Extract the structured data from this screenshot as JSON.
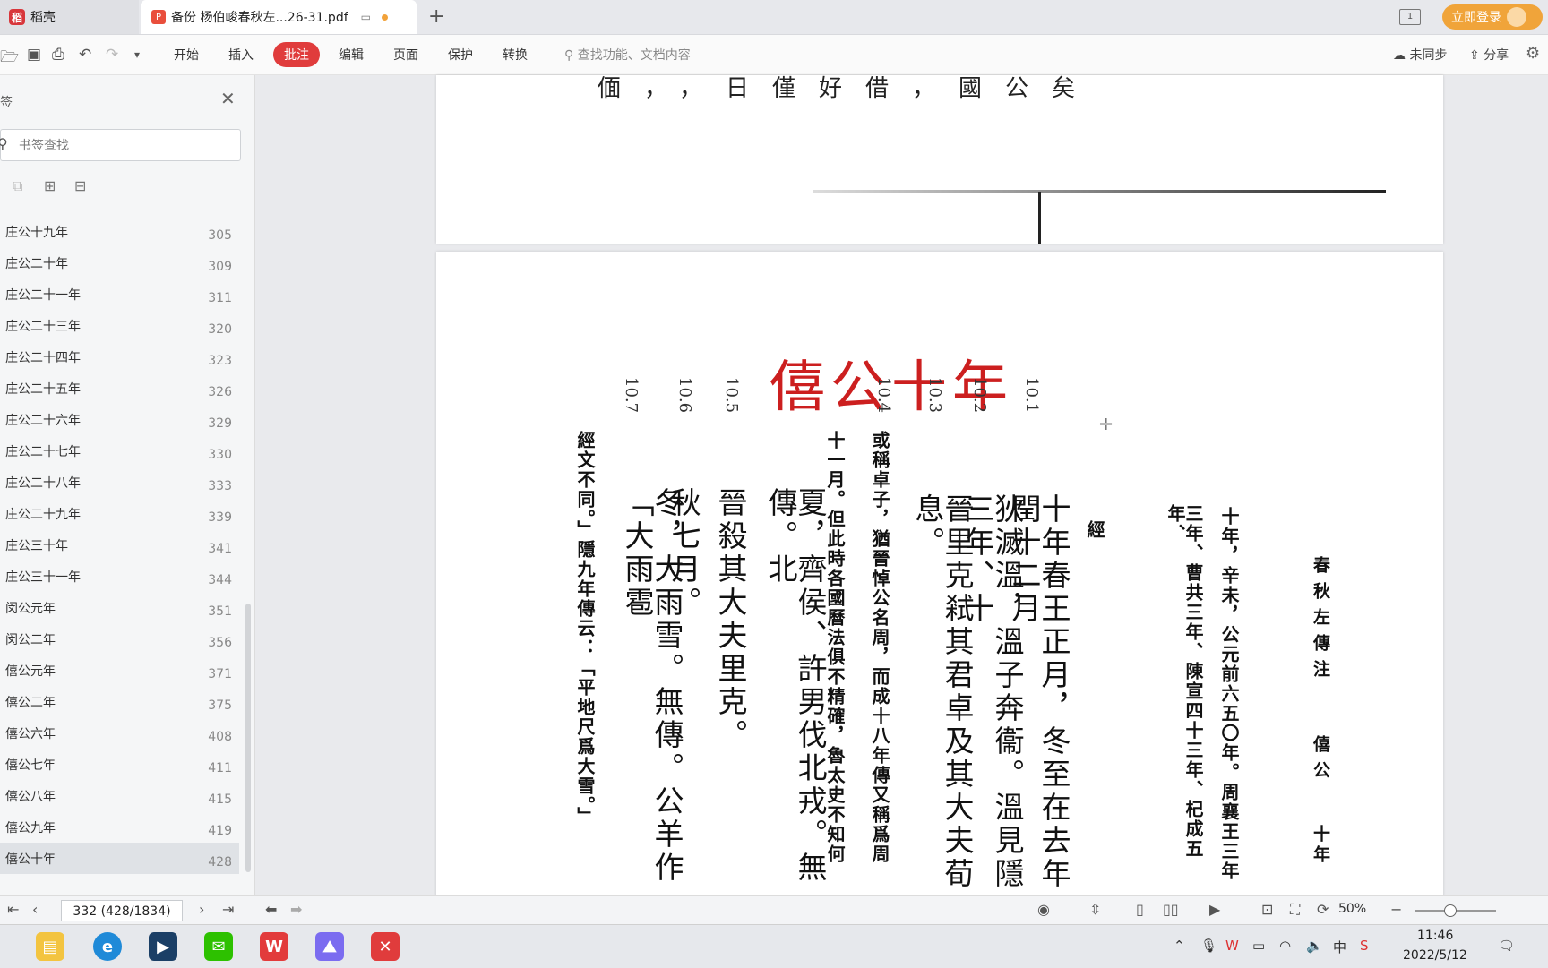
{
  "tabs": {
    "home_label": "稻壳",
    "doc_label": "备份 杨伯峻春秋左...26-31.pdf"
  },
  "header": {
    "login_label": "立即登录",
    "window_num": "1"
  },
  "toolbar": {
    "menus": [
      "开始",
      "插入",
      "批注",
      "编辑",
      "页面",
      "保护",
      "转换"
    ],
    "search_placeholder": "查找功能、文档内容",
    "sync_label": "未同步",
    "share_label": "分享"
  },
  "sidebar": {
    "title": "签",
    "search_placeholder": "书签查找",
    "items": [
      {
        "label": "庄公十九年",
        "page": "305"
      },
      {
        "label": "庄公二十年",
        "page": "309"
      },
      {
        "label": "庄公二十一年",
        "page": "311"
      },
      {
        "label": "庄公二十三年",
        "page": "320"
      },
      {
        "label": "庄公二十四年",
        "page": "323"
      },
      {
        "label": "庄公二十五年",
        "page": "326"
      },
      {
        "label": "庄公二十六年",
        "page": "329"
      },
      {
        "label": "庄公二十七年",
        "page": "330"
      },
      {
        "label": "庄公二十八年",
        "page": "333"
      },
      {
        "label": "庄公二十九年",
        "page": "339"
      },
      {
        "label": "庄公三十年",
        "page": "341"
      },
      {
        "label": "庄公三十一年",
        "page": "344"
      },
      {
        "label": "闵公元年",
        "page": "351"
      },
      {
        "label": "闵公二年",
        "page": "356"
      },
      {
        "label": "僖公元年",
        "page": "371"
      },
      {
        "label": "僖公二年",
        "page": "375"
      },
      {
        "label": "僖公六年",
        "page": "408"
      },
      {
        "label": "僖公七年",
        "page": "411"
      },
      {
        "label": "僖公八年",
        "page": "415"
      },
      {
        "label": "僖公九年",
        "page": "419"
      },
      {
        "label": "僖公十年",
        "page": "428"
      }
    ]
  },
  "document": {
    "top_strip": "偭，，日僅好借，國公矣",
    "title": "僖公十年",
    "header_book": "春秋左傳注",
    "header_duke": "僖公",
    "header_year": "十年",
    "columns": [
      {
        "text": "十年，辛未，公元前六五〇年。周襄王三年",
        "cls": "small"
      },
      {
        "text": "三年、曹共三年、陳宣四十三年、杞成五年、",
        "cls": "small"
      },
      {
        "text": "經",
        "cls": "small"
      },
      {
        "text": "十年春王正月，冬至在去年閏十二月",
        "cls": "big"
      },
      {
        "text": "狄滅溫，溫子奔衞。溫見隱三年、十",
        "cls": "big"
      },
      {
        "text": "晉里克弒其君卓及其大夫荀息。",
        "cls": "big"
      },
      {
        "text": "或稱卓子，猶晉悼公名周，而成十八年傳又稱爲周",
        "cls": "small"
      },
      {
        "text": "十一月。但此時各國曆法俱不精確，魯太史不知何",
        "cls": "small"
      },
      {
        "text": "夏，齊侯、許男伐北戎。無傳。北",
        "cls": "big"
      },
      {
        "text": "晉殺其大夫里克。",
        "cls": "big"
      },
      {
        "text": "秋七月。",
        "cls": "big"
      },
      {
        "text": "冬，大雨雪。無傳。公羊作「大雨雹",
        "cls": "big"
      },
      {
        "text": "經文不同。」隱九年傳云：「平地尺爲大雪。」",
        "cls": "small"
      }
    ],
    "section_nums": [
      "10.1",
      "10.2",
      "10.3",
      "10.4",
      "10.5",
      "10.6",
      "10.7"
    ]
  },
  "status": {
    "page_indicator": "332 (428/1834)",
    "zoom": "50%"
  },
  "taskbar": {
    "time": "11:46",
    "date": "2022/5/12"
  }
}
